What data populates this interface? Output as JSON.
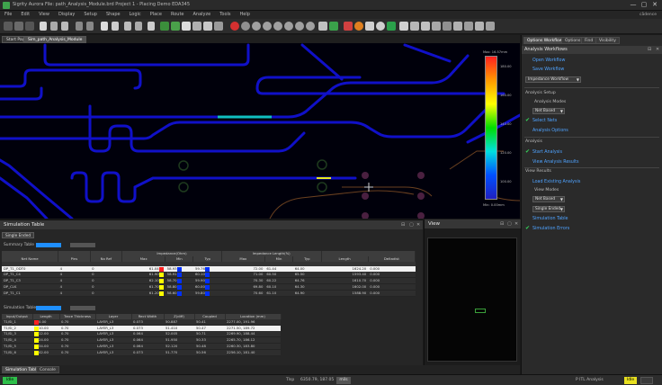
{
  "window": {
    "title": "Sigrity Aurora File: path_Analysis_Module.brd  Project 1 - Placing Demo EDA345",
    "controls": [
      "—",
      "▢",
      "✕"
    ]
  },
  "menubar": {
    "items": [
      "File",
      "Edit",
      "View",
      "Display",
      "Setup",
      "Shape",
      "Logic",
      "Place",
      "Route",
      "Analyze",
      "Tools",
      "Help"
    ],
    "right_text": "cādence"
  },
  "doc_tabs": [
    "Start Page",
    "Sim_path_Analysis_Module"
  ],
  "legend": {
    "top": "Max: 16.57mm",
    "values": [
      "180.00",
      "160.00",
      "140.00",
      "120.00",
      "100.00"
    ],
    "bottom": "Min: 0.00mm",
    "colors": [
      "#ff2020",
      "#ff9900",
      "#ffff00",
      "#00dd00",
      "#00e0e0",
      "#0050ff",
      "#2020c0"
    ]
  },
  "right_panel": {
    "tabs": [
      "Options Workflow",
      "Options",
      "Find",
      "Visibility"
    ],
    "header": "Analysis Workflows",
    "links": {
      "open_workflow": "Open Workflow",
      "save_workflow": "Save Workflow",
      "select_nets": "Select Nets",
      "analysis_options": "Analysis Options",
      "start_analysis": "Start Analysis",
      "view_analysis_results": "View Analysis Results",
      "load_existing_analysis": "Load Existing Analysis",
      "simulation_table": "Simulation Table",
      "simulation_errors": "Simulation Errors"
    },
    "workflow_select": "Impedance Workflow",
    "labels": {
      "analysis_setup": "Analysis Setup",
      "analysis_modes": "Analysis Modes",
      "analysis": "Analysis",
      "view_results": "View Results",
      "view_modes": "View Modes"
    },
    "mode_select": "Net Based",
    "view_select_1": "Net Based",
    "view_select_2": "Single Ended"
  },
  "sim_panel": {
    "title": "Simulation Table",
    "subtab": "Single Ended",
    "summary_label": "Summary Table",
    "simulation_label": "Simulation Table",
    "summary": {
      "group_headers": [
        "",
        "",
        "",
        "Impedance(Ohm)",
        "Impedance Length(%)",
        ""
      ],
      "headers": [
        "Net Name",
        "Pins",
        "No Ref",
        "Max",
        "Min",
        "Typ",
        "Max",
        "Min",
        "Typ",
        "Length",
        "Deltadist"
      ],
      "rows": [
        {
          "c": [
            "DP_T1_ODT0",
            "4",
            "0",
            "61.04",
            "58.93",
            "59.76",
            "72.00",
            "61.44",
            "64.00",
            "1624.20",
            "0.000"
          ],
          "selected": true,
          "sw": [
            "#ff2020",
            "#0030ff",
            "#0030ff"
          ]
        },
        {
          "c": [
            "DP_T1_C4",
            "4",
            "0",
            "61.90",
            "58.91",
            "60.10",
            "71.00",
            "60.50",
            "65.50",
            "1593.40",
            "0.000"
          ],
          "selected": false,
          "sw": [
            "#ffff00",
            "#0030ff",
            "#0030ff"
          ]
        },
        {
          "c": [
            "DP_T1_C3",
            "4",
            "0",
            "62.10",
            "58.70",
            "59.90",
            "70.30",
            "60.22",
            "64.76",
            "1610.70",
            "0.000"
          ],
          "selected": false,
          "sw": [
            "#ffff00",
            "#0030ff",
            "#0030ff"
          ]
        },
        {
          "c": [
            "DP_CLK",
            "4",
            "0",
            "61.70",
            "58.80",
            "60.00",
            "69.80",
            "60.10",
            "64.30",
            "1602.00",
            "0.000"
          ],
          "selected": false,
          "sw": [
            "#ffff00",
            "#0030ff",
            "#0030ff"
          ]
        },
        {
          "c": [
            "DP_T1_C1",
            "4",
            "0",
            "61.20",
            "58.60",
            "59.80",
            "70.60",
            "61.10",
            "64.90",
            "1588.90",
            "0.000"
          ],
          "selected": false,
          "sw": [
            "#ffff00",
            "#0030ff",
            "#0030ff"
          ]
        }
      ]
    },
    "detail": {
      "headers": [
        "Input/Output",
        "Length",
        "Trace Thickness",
        "Layer",
        "Rect Width",
        "Z(diff)",
        "Coupled",
        "Location (mm)"
      ],
      "rows": [
        {
          "c": [
            "T1/SI_1",
            "0.00",
            "0.70",
            "LAYER_L3",
            "0.073",
            "50.887",
            "50.41",
            "2277.00, 191.96"
          ],
          "selected": false,
          "sw": "#ff2020"
        },
        {
          "c": [
            "T1/SI_2",
            "10.00",
            "0.70",
            "LAYER_L3",
            "0.073",
            "51.410",
            "50.47",
            "2271.50, 189.72"
          ],
          "selected": true,
          "sw": "#ffff00"
        },
        {
          "c": [
            "T1/SI_3",
            "12.00",
            "0.70",
            "LAYER_L3",
            "0.064",
            "52.005",
            "50.71",
            "2269.90, 188.44"
          ],
          "selected": false,
          "sw": "#ffff00"
        },
        {
          "c": [
            "T1/SI_4",
            "24.00",
            "0.70",
            "LAYER_L3",
            "0.064",
            "51.950",
            "50.33",
            "2265.70, 186.12"
          ],
          "selected": false,
          "sw": "#ffff00"
        },
        {
          "c": [
            "T1/SI_5",
            "34.00",
            "0.70",
            "LAYER_L3",
            "0.064",
            "52.120",
            "50.48",
            "2260.30, 183.80"
          ],
          "selected": false,
          "sw": "#ffff00"
        },
        {
          "c": [
            "T1/SI_6",
            "42.00",
            "0.70",
            "LAYER_L3",
            "0.073",
            "51.770",
            "50.56",
            "2256.10, 181.40"
          ],
          "selected": false,
          "sw": "#ffff00"
        }
      ]
    }
  },
  "view_panel": {
    "title": "View"
  },
  "bottom_tabs": [
    "Simulation Table",
    "Console"
  ],
  "status_bar": {
    "left": "Idle",
    "mid_label": "Tlsp",
    "coords": "6350.79, 187.05",
    "units": "mils",
    "right": "P  ITL Analysis",
    "right_badge": "Idle"
  }
}
